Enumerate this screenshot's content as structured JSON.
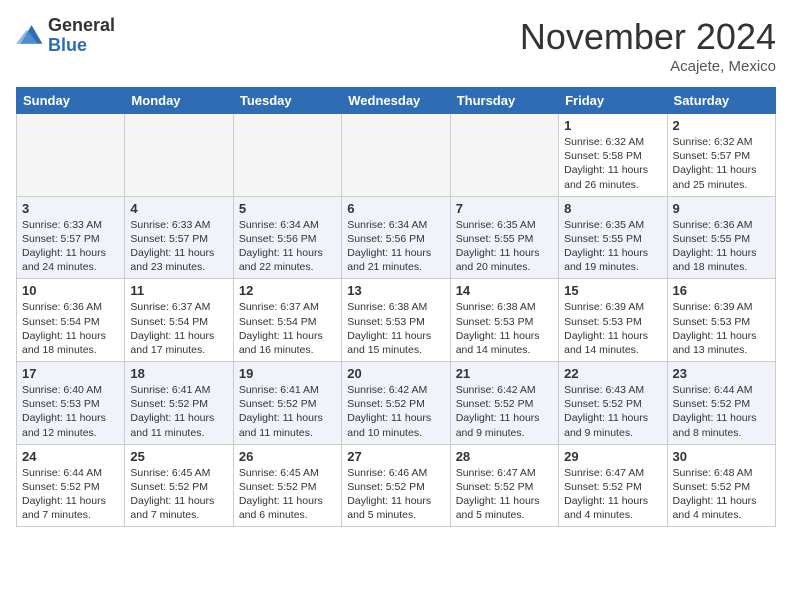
{
  "header": {
    "logo_general": "General",
    "logo_blue": "Blue",
    "month_title": "November 2024",
    "location": "Acajete, Mexico"
  },
  "weekdays": [
    "Sunday",
    "Monday",
    "Tuesday",
    "Wednesday",
    "Thursday",
    "Friday",
    "Saturday"
  ],
  "weeks": [
    [
      {
        "day": "",
        "info": ""
      },
      {
        "day": "",
        "info": ""
      },
      {
        "day": "",
        "info": ""
      },
      {
        "day": "",
        "info": ""
      },
      {
        "day": "",
        "info": ""
      },
      {
        "day": "1",
        "info": "Sunrise: 6:32 AM\nSunset: 5:58 PM\nDaylight: 11 hours\nand 26 minutes."
      },
      {
        "day": "2",
        "info": "Sunrise: 6:32 AM\nSunset: 5:57 PM\nDaylight: 11 hours\nand 25 minutes."
      }
    ],
    [
      {
        "day": "3",
        "info": "Sunrise: 6:33 AM\nSunset: 5:57 PM\nDaylight: 11 hours\nand 24 minutes."
      },
      {
        "day": "4",
        "info": "Sunrise: 6:33 AM\nSunset: 5:57 PM\nDaylight: 11 hours\nand 23 minutes."
      },
      {
        "day": "5",
        "info": "Sunrise: 6:34 AM\nSunset: 5:56 PM\nDaylight: 11 hours\nand 22 minutes."
      },
      {
        "day": "6",
        "info": "Sunrise: 6:34 AM\nSunset: 5:56 PM\nDaylight: 11 hours\nand 21 minutes."
      },
      {
        "day": "7",
        "info": "Sunrise: 6:35 AM\nSunset: 5:55 PM\nDaylight: 11 hours\nand 20 minutes."
      },
      {
        "day": "8",
        "info": "Sunrise: 6:35 AM\nSunset: 5:55 PM\nDaylight: 11 hours\nand 19 minutes."
      },
      {
        "day": "9",
        "info": "Sunrise: 6:36 AM\nSunset: 5:55 PM\nDaylight: 11 hours\nand 18 minutes."
      }
    ],
    [
      {
        "day": "10",
        "info": "Sunrise: 6:36 AM\nSunset: 5:54 PM\nDaylight: 11 hours\nand 18 minutes."
      },
      {
        "day": "11",
        "info": "Sunrise: 6:37 AM\nSunset: 5:54 PM\nDaylight: 11 hours\nand 17 minutes."
      },
      {
        "day": "12",
        "info": "Sunrise: 6:37 AM\nSunset: 5:54 PM\nDaylight: 11 hours\nand 16 minutes."
      },
      {
        "day": "13",
        "info": "Sunrise: 6:38 AM\nSunset: 5:53 PM\nDaylight: 11 hours\nand 15 minutes."
      },
      {
        "day": "14",
        "info": "Sunrise: 6:38 AM\nSunset: 5:53 PM\nDaylight: 11 hours\nand 14 minutes."
      },
      {
        "day": "15",
        "info": "Sunrise: 6:39 AM\nSunset: 5:53 PM\nDaylight: 11 hours\nand 14 minutes."
      },
      {
        "day": "16",
        "info": "Sunrise: 6:39 AM\nSunset: 5:53 PM\nDaylight: 11 hours\nand 13 minutes."
      }
    ],
    [
      {
        "day": "17",
        "info": "Sunrise: 6:40 AM\nSunset: 5:53 PM\nDaylight: 11 hours\nand 12 minutes."
      },
      {
        "day": "18",
        "info": "Sunrise: 6:41 AM\nSunset: 5:52 PM\nDaylight: 11 hours\nand 11 minutes."
      },
      {
        "day": "19",
        "info": "Sunrise: 6:41 AM\nSunset: 5:52 PM\nDaylight: 11 hours\nand 11 minutes."
      },
      {
        "day": "20",
        "info": "Sunrise: 6:42 AM\nSunset: 5:52 PM\nDaylight: 11 hours\nand 10 minutes."
      },
      {
        "day": "21",
        "info": "Sunrise: 6:42 AM\nSunset: 5:52 PM\nDaylight: 11 hours\nand 9 minutes."
      },
      {
        "day": "22",
        "info": "Sunrise: 6:43 AM\nSunset: 5:52 PM\nDaylight: 11 hours\nand 9 minutes."
      },
      {
        "day": "23",
        "info": "Sunrise: 6:44 AM\nSunset: 5:52 PM\nDaylight: 11 hours\nand 8 minutes."
      }
    ],
    [
      {
        "day": "24",
        "info": "Sunrise: 6:44 AM\nSunset: 5:52 PM\nDaylight: 11 hours\nand 7 minutes."
      },
      {
        "day": "25",
        "info": "Sunrise: 6:45 AM\nSunset: 5:52 PM\nDaylight: 11 hours\nand 7 minutes."
      },
      {
        "day": "26",
        "info": "Sunrise: 6:45 AM\nSunset: 5:52 PM\nDaylight: 11 hours\nand 6 minutes."
      },
      {
        "day": "27",
        "info": "Sunrise: 6:46 AM\nSunset: 5:52 PM\nDaylight: 11 hours\nand 5 minutes."
      },
      {
        "day": "28",
        "info": "Sunrise: 6:47 AM\nSunset: 5:52 PM\nDaylight: 11 hours\nand 5 minutes."
      },
      {
        "day": "29",
        "info": "Sunrise: 6:47 AM\nSunset: 5:52 PM\nDaylight: 11 hours\nand 4 minutes."
      },
      {
        "day": "30",
        "info": "Sunrise: 6:48 AM\nSunset: 5:52 PM\nDaylight: 11 hours\nand 4 minutes."
      }
    ]
  ]
}
